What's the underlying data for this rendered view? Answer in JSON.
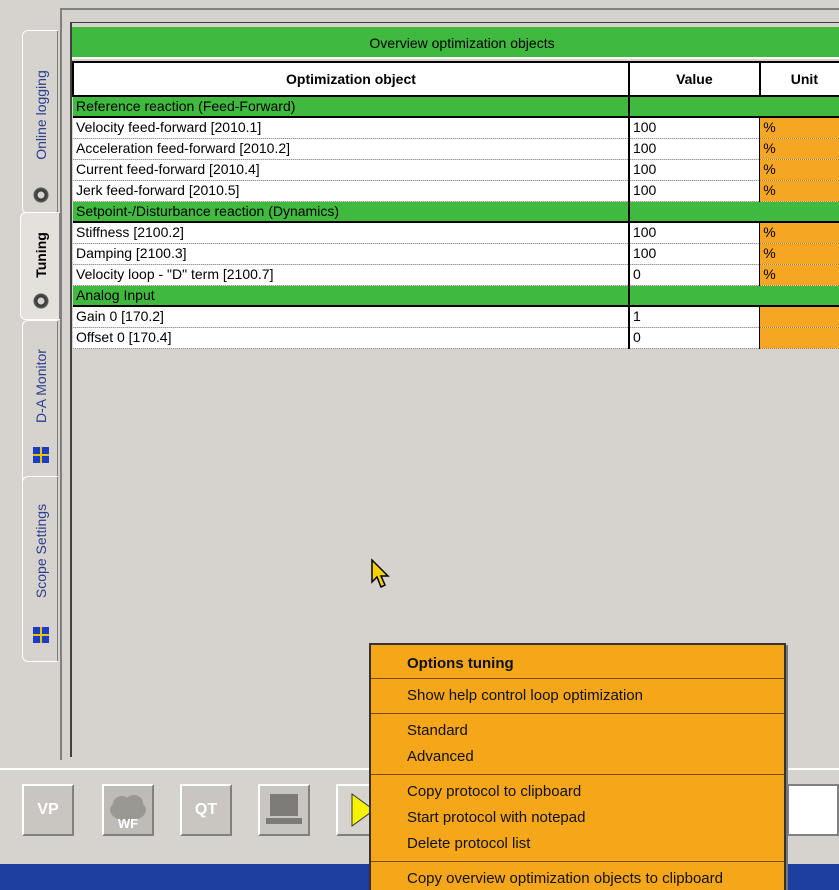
{
  "tabs": [
    {
      "label": "Online logging",
      "icon": "gear-icon"
    },
    {
      "label": "Tuning",
      "icon": "gear-icon",
      "active": true
    },
    {
      "label": "D-A Monitor",
      "icon": "flag-icon"
    },
    {
      "label": "Scope Settings",
      "icon": "flag-icon"
    }
  ],
  "grid": {
    "title": "Overview optimization objects",
    "columns": [
      "Optimization object",
      "Value",
      "Unit"
    ],
    "rows": [
      {
        "group": true,
        "name": "Reference reaction (Feed-Forward)"
      },
      {
        "name": "Velocity feed-forward [2010.1]",
        "value": "100",
        "unit": "%"
      },
      {
        "name": "Acceleration feed-forward [2010.2]",
        "value": "100",
        "unit": "%"
      },
      {
        "name": "Current feed-forward [2010.4]",
        "value": "100",
        "unit": "%"
      },
      {
        "name": "Jerk feed-forward [2010.5]",
        "value": "100",
        "unit": "%"
      },
      {
        "group": true,
        "name": "Setpoint-/Disturbance reaction (Dynamics)"
      },
      {
        "name": "Stiffness [2100.2]",
        "value": "100",
        "unit": "%"
      },
      {
        "name": "Damping [2100.3]",
        "value": "100",
        "unit": "%"
      },
      {
        "name": "Velocity loop - \"D\" term [2100.7]",
        "value": "0",
        "unit": "%"
      },
      {
        "group": true,
        "name": "Analog Input"
      },
      {
        "name": "Gain 0 [170.2]",
        "value": "1",
        "unit": ""
      },
      {
        "name": "Offset 0 [170.4]",
        "value": "0",
        "unit": ""
      }
    ]
  },
  "toolbar": {
    "buttons": [
      "VP",
      "WF",
      "QT",
      "",
      ""
    ]
  },
  "menu": {
    "title": "Options tuning",
    "items": [
      [
        "Show help control loop optimization"
      ],
      [
        "Standard",
        "Advanced"
      ],
      [
        "Copy protocol to clipboard",
        "Start protocol with notepad",
        "Delete protocol list"
      ],
      [
        "Copy overview optimization objects to clipboard"
      ]
    ]
  },
  "colors": {
    "group_green": "#3fba3f",
    "unit_orange": "#f5a623",
    "menu_orange": "#f5a619"
  }
}
